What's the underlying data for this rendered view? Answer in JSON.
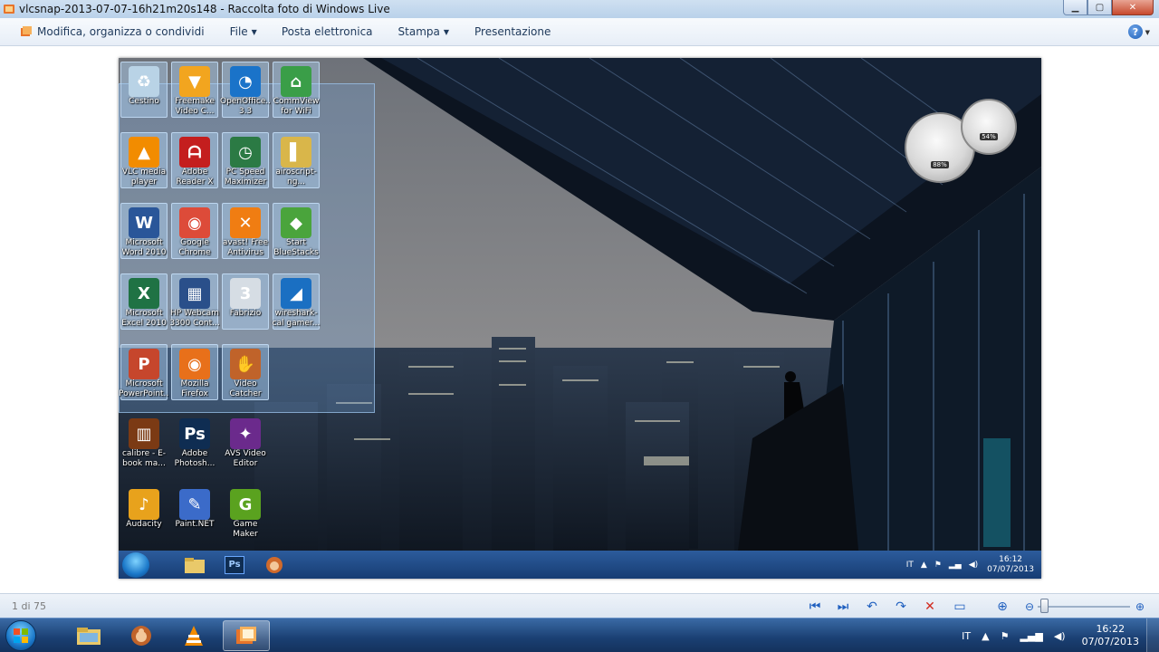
{
  "window": {
    "title": "vlcsnap-2013-07-07-16h21m20s148 - Raccolta foto di Windows Live"
  },
  "menu": {
    "items": [
      {
        "label": "Modifica, organizza o condividi",
        "dropdown": false
      },
      {
        "label": "File",
        "dropdown": true
      },
      {
        "label": "Posta elettronica",
        "dropdown": false
      },
      {
        "label": "Stampa",
        "dropdown": true
      },
      {
        "label": "Presentazione",
        "dropdown": false
      }
    ],
    "help_label": "?"
  },
  "desktop_icons": [
    {
      "label": "Cestino",
      "icon": "recycle-bin-icon",
      "color": "#b9d3e6",
      "glyph": "♻"
    },
    {
      "label": "Freemake Video C...",
      "icon": "freemake-icon",
      "color": "#f2a51f",
      "glyph": "▼"
    },
    {
      "label": "OpenOffice... 3.3",
      "icon": "openoffice-icon",
      "color": "#1a73c9",
      "glyph": "◔"
    },
    {
      "label": "CommView for WiFi",
      "icon": "commview-icon",
      "color": "#3a9e48",
      "glyph": "⌂"
    },
    {
      "label": "VLC media player",
      "icon": "vlc-icon",
      "color": "#f28c00",
      "glyph": "▲"
    },
    {
      "label": "Adobe Reader X",
      "icon": "adobe-reader-icon",
      "color": "#c41e1e",
      "glyph": "ᗩ"
    },
    {
      "label": "PC Speed Maximizer",
      "icon": "pc-speed-icon",
      "color": "#2b7a44",
      "glyph": "◷"
    },
    {
      "label": "airoscript-ng...",
      "icon": "folder-icon",
      "color": "#d9b64a",
      "glyph": "▌"
    },
    {
      "label": "Microsoft Word 2010",
      "icon": "word-icon",
      "color": "#2a5699",
      "glyph": "W"
    },
    {
      "label": "Google Chrome",
      "icon": "chrome-icon",
      "color": "#dd4b39",
      "glyph": "◉"
    },
    {
      "label": "avast! Free Antivirus",
      "icon": "avast-icon",
      "color": "#f07d12",
      "glyph": "✕"
    },
    {
      "label": "Start BlueStacks",
      "icon": "bluestacks-icon",
      "color": "#4aa43c",
      "glyph": "◆"
    },
    {
      "label": "Microsoft Excel 2010",
      "icon": "excel-icon",
      "color": "#1f7244",
      "glyph": "X"
    },
    {
      "label": "HP Webcam 3300 Cont...",
      "icon": "webcam-icon",
      "color": "#2a4f8a",
      "glyph": "▦"
    },
    {
      "label": "Fabrizio",
      "icon": "three-icon",
      "color": "#d6dde4",
      "glyph": "3"
    },
    {
      "label": "wireshark-cal gamer...",
      "icon": "wireshark-icon",
      "color": "#1a6fc2",
      "glyph": "◢"
    },
    {
      "label": "Microsoft PowerPoint...",
      "icon": "powerpoint-icon",
      "color": "#c6462c",
      "glyph": "P"
    },
    {
      "label": "Mozilla Firefox",
      "icon": "firefox-icon",
      "color": "#e8701a",
      "glyph": "◉"
    },
    {
      "label": "Video Catcher",
      "icon": "video-catcher-icon",
      "color": "#c0632a",
      "glyph": "✋"
    },
    {
      "label": "calibre - E-book ma...",
      "icon": "calibre-icon",
      "color": "#7b3a14",
      "glyph": "▥"
    },
    {
      "label": "Adobe Photosh...",
      "icon": "photoshop-icon",
      "color": "#0f2d52",
      "glyph": "Ps"
    },
    {
      "label": "AVS Video Editor",
      "icon": "avs-icon",
      "color": "#6b2a8c",
      "glyph": "✦"
    },
    {
      "label": "Audacity",
      "icon": "audacity-icon",
      "color": "#e8a21c",
      "glyph": "♪"
    },
    {
      "label": "Paint.NET",
      "icon": "paintnet-icon",
      "color": "#3b6bc9",
      "glyph": "✎"
    },
    {
      "label": "Game Maker",
      "icon": "game-maker-icon",
      "color": "#5aa21f",
      "glyph": "G"
    }
  ],
  "gadgets": {
    "cpu_percent": "88%",
    "ram_percent": "54%"
  },
  "inner_taskbar": {
    "lang": "IT",
    "time": "16:12",
    "date": "07/07/2013"
  },
  "status_bar": {
    "counter": "1 di 75"
  },
  "taskbar": {
    "lang": "IT",
    "time": "16:22",
    "date": "07/07/2013",
    "pinned": [
      {
        "name": "explorer",
        "icon": "folder-icon"
      },
      {
        "name": "video-catcher",
        "icon": "video-catcher-icon"
      },
      {
        "name": "vlc",
        "icon": "vlc-icon"
      },
      {
        "name": "photo-gallery",
        "icon": "photo-gallery-icon"
      }
    ]
  }
}
